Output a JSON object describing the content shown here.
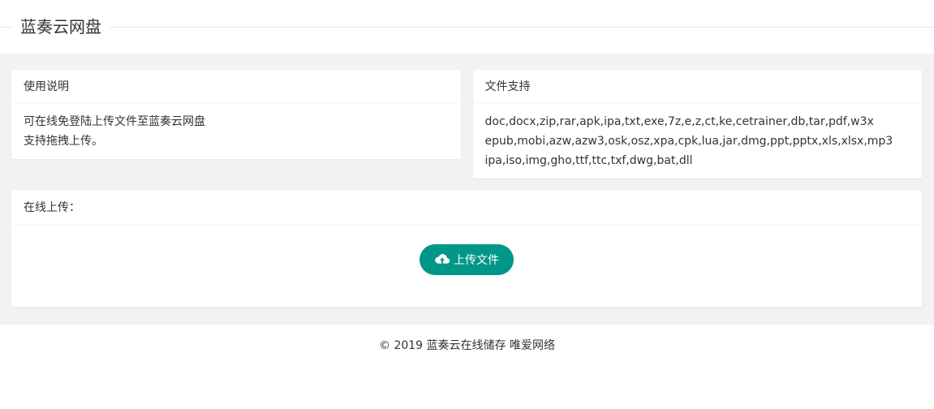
{
  "header": {
    "title": "蓝奏云网盘"
  },
  "usage": {
    "title": "使用说明",
    "lines": [
      "可在线免登陆上传文件至蓝奏云网盘",
      "支持拖拽上传。"
    ]
  },
  "formats": {
    "title": "文件支持",
    "lines": [
      "doc,docx,zip,rar,apk,ipa,txt,exe,7z,e,z,ct,ke,cetrainer,db,tar,pdf,w3x",
      "epub,mobi,azw,azw3,osk,osz,xpa,cpk,lua,jar,dmg,ppt,pptx,xls,xlsx,mp3",
      "ipa,iso,img,gho,ttf,ttc,txf,dwg,bat,dll"
    ]
  },
  "upload": {
    "title": "在线上传：",
    "button_label": "上传文件",
    "button_icon": "cloud-upload-icon",
    "accent_color": "#009688"
  },
  "footer": {
    "text": "© 2019 蓝奏云在线储存 唯爱网络"
  }
}
